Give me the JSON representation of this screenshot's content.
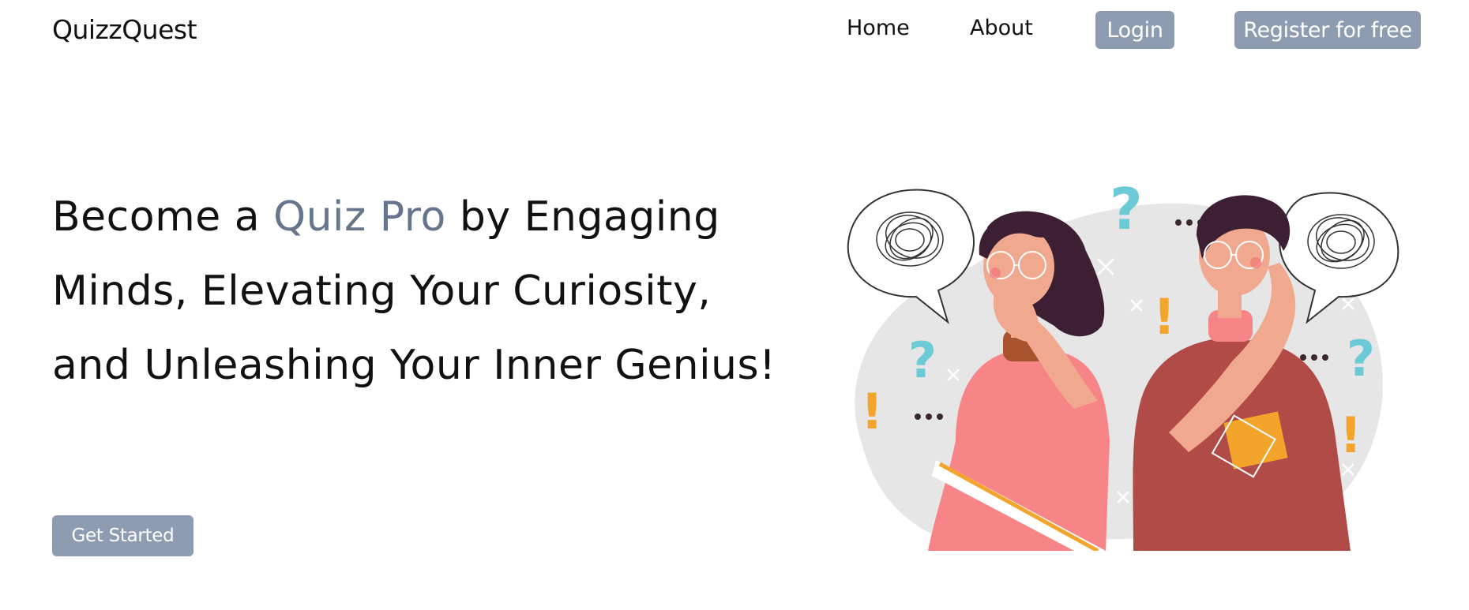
{
  "header": {
    "brand": "QuizzQuest",
    "nav": {
      "home": "Home",
      "about": "About"
    },
    "login_label": "Login",
    "register_label": "Register for free"
  },
  "hero": {
    "headline_before": "Become a ",
    "headline_accent": "Quiz Pro",
    "headline_after": " by Engaging Minds, Elevating Your Curiosity, and Unleashing Your Inner Genius!",
    "cta_label": "Get Started",
    "illustration_icon": "thinking-people-illustration"
  },
  "colors": {
    "button_bg": "#8e9cb1",
    "accent_text": "#66758c",
    "text": "#111111",
    "background": "#ffffff"
  }
}
